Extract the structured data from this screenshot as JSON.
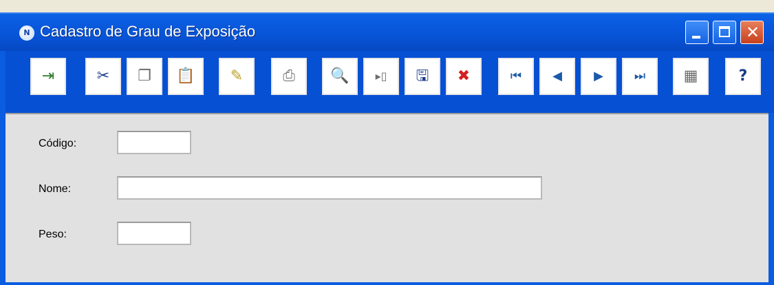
{
  "window": {
    "title": "Cadastro de Grau de Exposição",
    "app_icon_letter": "N",
    "close_glyph": "✕"
  },
  "toolbar": {
    "buttons": [
      {
        "name": "exit-button",
        "icon": "exit-door-icon",
        "glyph": "⇥"
      },
      {
        "name": "cut-button",
        "icon": "scissors-icon",
        "glyph": "✂"
      },
      {
        "name": "copy-button",
        "icon": "copy-icon",
        "glyph": "❐"
      },
      {
        "name": "paste-button",
        "icon": "paste-icon",
        "glyph": "📋"
      },
      {
        "name": "new-button",
        "icon": "new-document-icon",
        "glyph": "✎"
      },
      {
        "name": "print-button",
        "icon": "printer-icon",
        "glyph": "⎙"
      },
      {
        "name": "search-button",
        "icon": "search-icon",
        "glyph": "🔍"
      },
      {
        "name": "insert-button",
        "icon": "insert-record-icon",
        "glyph": "▸▯"
      },
      {
        "name": "save-button",
        "icon": "save-disk-icon",
        "glyph": "🖫"
      },
      {
        "name": "delete-button",
        "icon": "delete-record-icon",
        "glyph": "✖"
      },
      {
        "name": "first-record-button",
        "icon": "first-record-icon",
        "glyph": "⏮"
      },
      {
        "name": "previous-record-button",
        "icon": "previous-icon",
        "glyph": "◀"
      },
      {
        "name": "next-record-button",
        "icon": "next-icon",
        "glyph": "▶"
      },
      {
        "name": "last-record-button",
        "icon": "last-record-icon",
        "glyph": "⏭"
      },
      {
        "name": "grid-view-button",
        "icon": "grid-icon",
        "glyph": "▦"
      },
      {
        "name": "help-button",
        "icon": "help-icon",
        "glyph": "?"
      }
    ]
  },
  "form": {
    "codigo_label": "Código:",
    "codigo_value": "",
    "nome_label": "Nome:",
    "nome_value": "",
    "peso_label": "Peso:",
    "peso_value": ""
  }
}
